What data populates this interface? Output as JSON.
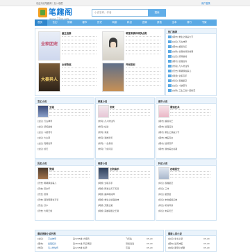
{
  "topbar": {
    "left": "欢迎光临笔趣阁！加入收藏",
    "right": "用户登录"
  },
  "logo": {
    "name": "笔趣阁",
    "url": "www.77xs.org"
  },
  "search": {
    "placeholder": "小说名称、作者",
    "button": "搜索"
  },
  "nav": [
    "首页",
    "玄幻",
    "修真",
    "都市",
    "历史",
    "网游",
    "科幻",
    "言情",
    "其他",
    "全本",
    "排行",
    "书架"
  ],
  "featured": [
    {
      "title": "重生追妻",
      "cover_text": "全家团宠"
    },
    {
      "title": "萌宝来袭妈咪快点跑",
      "cover_text": ""
    },
    {
      "title": "全球降临",
      "cover_text": "大秦异人"
    },
    {
      "title": "开局签到",
      "cover_text": ""
    }
  ],
  "rank": {
    "title": "热门推荐",
    "items": [
      "[都市] 重生之我是大亨",
      "[玄幻] 万古神帝",
      "[都市] 超级兵王",
      "[言情] 总裁的替身前妻",
      "[玄幻] 武炼巅峰",
      "[都市] 最强狂兵",
      "[修真] 凡人修仙传",
      "[历史] 明朝那些事儿",
      "[网游] 全职高手",
      "[科幻] 吞噬星空",
      "[玄幻] 斗破苍穹",
      "[言情] 三生三世十里桃花"
    ]
  },
  "sections": [
    {
      "name": "玄幻小说",
      "book": "圣墟",
      "lines": [
        "[玄幻] 万古神帝",
        "[玄幻] 武炼巅峰",
        "[玄幻] 斗破苍穹",
        "[玄幻] 大主宰",
        "[玄幻] 完美世界",
        "[玄幻] 遮天"
      ]
    },
    {
      "name": "修真小说",
      "book": "剑来",
      "lines": [
        "[修真] 凡人修仙传",
        "[修真] 仙逆",
        "[修真] 求魔",
        "[修真] 我欲封天",
        "[修真] 一念永恒",
        "[修真] 飞剑问道"
      ]
    },
    {
      "name": "都市小说",
      "book": "最强狂兵",
      "lines": [
        "[都市] 超级兵王",
        "[都市] 最强狂兵",
        "[都市] 重生之我是大亨",
        "[都市] 神医弃女",
        "[都市] 透视高手",
        "[都市] 我的美女总裁"
      ]
    },
    {
      "name": "历史小说",
      "book": "赘婿",
      "lines": [
        "[历史] 明朝那些事儿",
        "[历史] 庆余年",
        "[历史] 唐砖",
        "[历史] 回到明朝当王爷",
        "[历史] 汉乡",
        "[历史] 大明王侯"
      ]
    },
    {
      "name": "网游小说",
      "book": "全职高手",
      "lines": [
        "[网游] 全职高手",
        "[网游] 网游之天下无双",
        "[网游] 超神机械师",
        "[网游] 重生之最强剑神",
        "[网游] 天醒之路",
        "[网游] 英雄联盟之王者"
      ]
    },
    {
      "name": "科幻小说",
      "book": "吞噬星空",
      "lines": [
        "[科幻] 吞噬星空",
        "[科幻] 三体",
        "[科幻] 星辰变",
        "[科幻] 末世超级系统",
        "[科幻] 机动风暴",
        "[科幻] 未来天王"
      ]
    }
  ],
  "update_title": "最近更新小说列表",
  "updates": [
    [
      "[玄幻]",
      "万古神帝",
      "第3285章 大结局",
      "飞天鱼",
      "05-20"
    ],
    [
      "[都市]",
      "最强狂兵",
      "第2801章 风云再起",
      "烈焰滔滔",
      "05-20"
    ],
    [
      "[修真]",
      "凡人修仙传",
      "第1205章 仙界",
      "忘语",
      "05-20"
    ],
    [
      "[历史]",
      "庆余年",
      "第七卷 第一章",
      "猫腻",
      "05-20"
    ],
    [
      "[网游]",
      "全职高手",
      "第1728章 再战",
      "蝴蝶蓝",
      "05-20"
    ]
  ],
  "new_title": "最新入库小说",
  "news": [
    [
      "[玄幻] 新书上架",
      "05-20"
    ],
    [
      "[都市] 逆天神医",
      "05-20"
    ],
    [
      "[言情] 甜宠小娇妻",
      "05-20"
    ],
    [
      "[科幻] 星际穿越",
      "05-20"
    ],
    [
      "[修真] 仙道长青",
      "05-20"
    ]
  ]
}
